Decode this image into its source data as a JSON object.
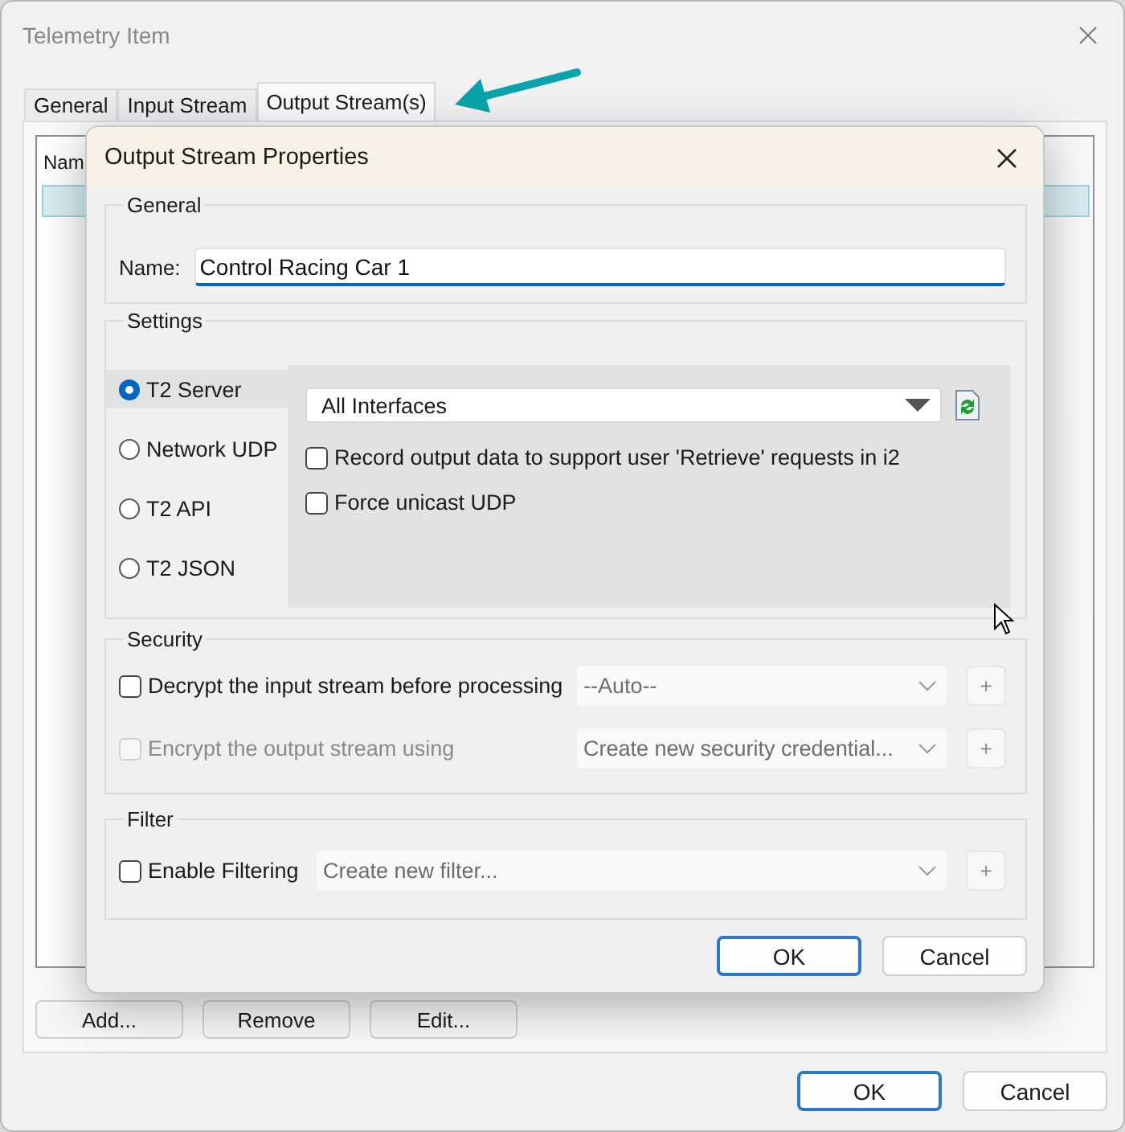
{
  "window": {
    "title": "Telemetry Item"
  },
  "tabs": [
    {
      "label": "General",
      "selected": false
    },
    {
      "label": "Input Stream",
      "selected": false
    },
    {
      "label": "Output Stream(s)",
      "selected": true
    }
  ],
  "list": {
    "columns": [
      "Nam"
    ],
    "rows": [
      {
        "selected": true
      }
    ]
  },
  "list_buttons": [
    "Add...",
    "Remove",
    "Edit..."
  ],
  "buttons": [
    {
      "label": "OK",
      "default": true
    },
    {
      "label": "Cancel",
      "default": false
    }
  ],
  "dialog": {
    "title": "Output Stream Properties",
    "general": {
      "title": "General",
      "name_label": "Name:",
      "name_value": "Control Racing Car 1"
    },
    "settings": {
      "title": "Settings",
      "modes": [
        {
          "label": "T2 Server",
          "selected": true
        },
        {
          "label": "Network UDP",
          "selected": false
        },
        {
          "label": "T2 API",
          "selected": false
        },
        {
          "label": "T2 JSON",
          "selected": false
        }
      ],
      "interface": "All Interfaces",
      "options": [
        {
          "label": "Record output data to support user 'Retrieve' requests in i2",
          "checked": false
        },
        {
          "label": "Force unicast UDP",
          "checked": false
        }
      ]
    },
    "security": {
      "title": "Security",
      "rows": [
        {
          "label": "Decrypt the input stream before processing",
          "checked": false,
          "disabled": false,
          "combo": "--Auto--",
          "add": "+"
        },
        {
          "label": "Encrypt the output stream using",
          "checked": false,
          "disabled": true,
          "combo": "Create new security credential...",
          "add": "+"
        }
      ]
    },
    "filter": {
      "title": "Filter",
      "rows": [
        {
          "label": "Enable Filtering",
          "checked": false,
          "disabled": false,
          "combo": "Create new filter...",
          "add": "+"
        }
      ]
    },
    "buttons": [
      {
        "label": "OK",
        "default": true
      },
      {
        "label": "Cancel",
        "default": false
      }
    ]
  }
}
